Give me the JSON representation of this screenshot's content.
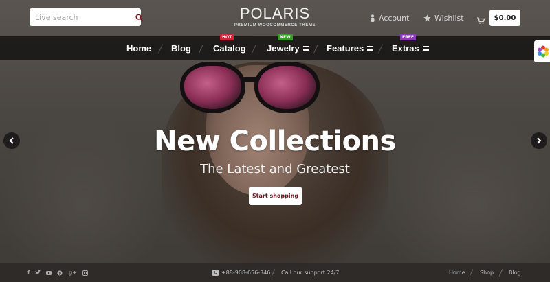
{
  "header": {
    "search": {
      "placeholder": "Live search",
      "value": ""
    },
    "logo": {
      "title": "POLARIS",
      "subtitle": "PREMIUM WOOCOMMERCE THEME"
    },
    "account_label": "Account",
    "wishlist_label": "Wishlist",
    "cart_total": "$0.00"
  },
  "nav": {
    "items": [
      {
        "label": "Home"
      },
      {
        "label": "Blog"
      },
      {
        "label": "Catalog",
        "badge": "HOT",
        "badge_color": "#d0243a"
      },
      {
        "label": "Jewelry",
        "badge": "NEW",
        "badge_color": "#3a9a2c"
      },
      {
        "label": "Features"
      },
      {
        "label": "Extras",
        "badge": "FREE",
        "badge_color": "#8a3bb4"
      }
    ]
  },
  "hero": {
    "title": "New Collections",
    "subtitle": "The Latest and Greatest",
    "cta_label": "Start shopping"
  },
  "footer": {
    "social_icons": [
      "facebook-icon",
      "twitter-icon",
      "youtube-icon",
      "pinterest-icon",
      "google-plus-icon",
      "instagram-icon"
    ],
    "phone": "+88-908-656-346",
    "support": "Call our support 24/7",
    "links": [
      "Home",
      "Shop",
      "Blog"
    ]
  },
  "colors": {
    "nav_background": "#1a1818",
    "cta_text": "#6e1420",
    "search_icon": "#7a1420"
  }
}
